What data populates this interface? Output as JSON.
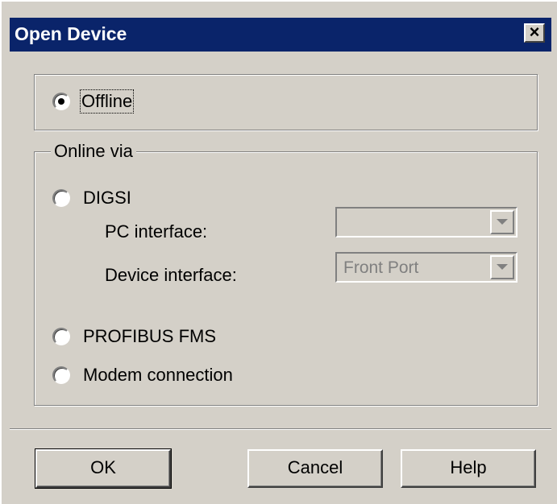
{
  "window": {
    "title": "Open Device",
    "close_glyph": "×"
  },
  "offline": {
    "label": "Offline",
    "selected": true
  },
  "online": {
    "legend": "Online via",
    "options": [
      {
        "label": "DIGSI",
        "selected": false
      },
      {
        "label": "PROFIBUS FMS",
        "selected": false
      },
      {
        "label": "Modem connection",
        "selected": false
      }
    ],
    "pc_interface": {
      "label": "PC interface:",
      "value": ""
    },
    "device_interface": {
      "label": "Device interface:",
      "value": "Front Port"
    }
  },
  "buttons": {
    "ok": "OK",
    "cancel": "Cancel",
    "help": "Help"
  }
}
